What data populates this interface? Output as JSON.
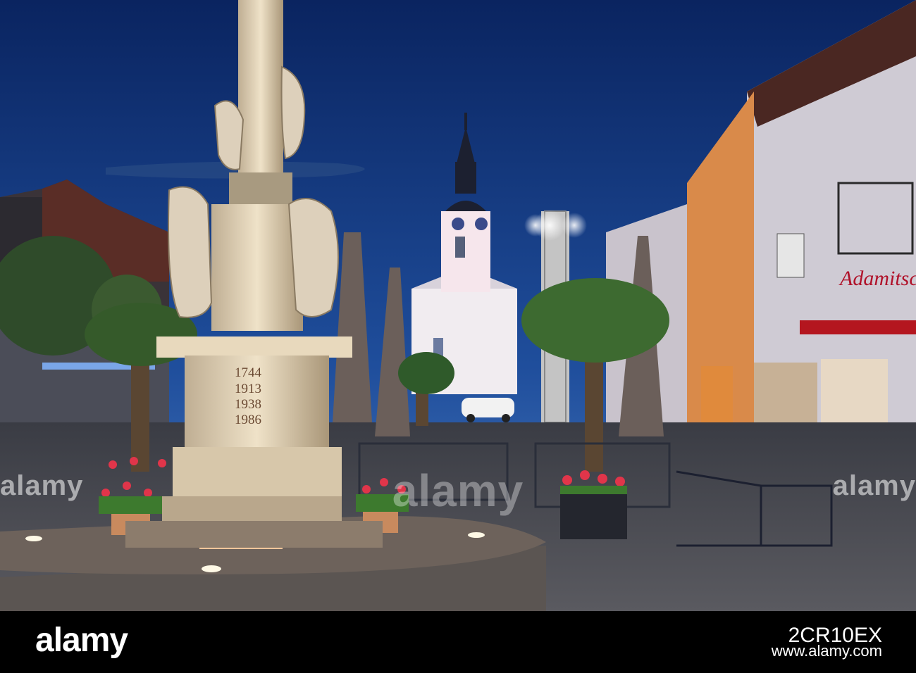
{
  "monument": {
    "years": [
      "1744",
      "1913",
      "1938",
      "1986"
    ]
  },
  "shop": {
    "sign": "Adamitsch"
  },
  "watermark": {
    "logo": "alamy"
  },
  "footer": {
    "logo": "alamy",
    "image_id": "2CR10EX",
    "url": "www.alamy.com"
  },
  "colors": {
    "sky_top": "#0d2a66",
    "sky_bottom": "#3d6fb8",
    "footer_bg": "#000000",
    "shop_sign": "#b0122a"
  }
}
